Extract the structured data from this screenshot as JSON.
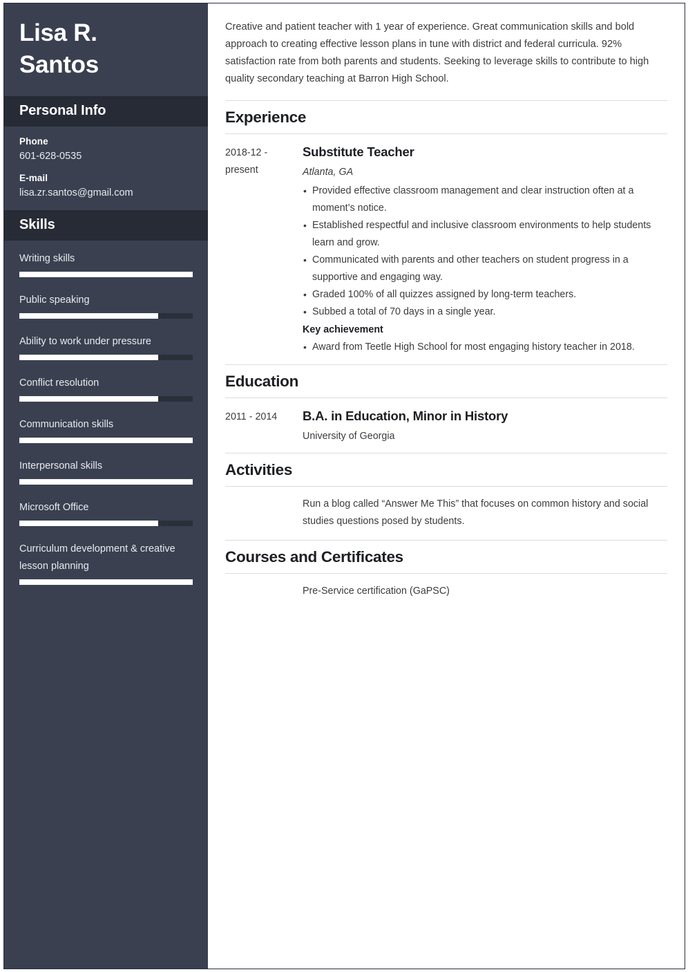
{
  "sidebar": {
    "name_lines": [
      "Lisa R.",
      "Santos"
    ],
    "personal_info": {
      "header": "Personal Info",
      "fields": [
        {
          "label": "Phone",
          "value": "601-628-0535"
        },
        {
          "label": "E-mail",
          "value": "lisa.zr.santos@gmail.com"
        }
      ]
    },
    "skills": {
      "header": "Skills",
      "items": [
        {
          "label": "Writing skills",
          "level": 100
        },
        {
          "label": "Public speaking",
          "level": 80
        },
        {
          "label": "Ability to work under pressure",
          "level": 80
        },
        {
          "label": "Conflict resolution",
          "level": 80
        },
        {
          "label": "Communication skills",
          "level": 100
        },
        {
          "label": "Interpersonal skills",
          "level": 100
        },
        {
          "label": "Microsoft Office",
          "level": 80
        },
        {
          "label": "Curriculum development & creative lesson planning",
          "level": 100
        }
      ]
    }
  },
  "main": {
    "summary": "Creative and patient teacher with 1 year of experience. Great communication skills and bold approach to creating effective lesson plans in tune with district and federal curricula. 92% satisfaction rate from both parents and students. Seeking to leverage skills to contribute to high quality secondary teaching at Barron High School.",
    "experience": {
      "title": "Experience",
      "entries": [
        {
          "dates": "2018-12 - present",
          "job_title": "Substitute Teacher",
          "location": "Atlanta, GA",
          "bullets": [
            "Provided effective classroom management and clear instruction often at a moment’s notice.",
            "Established respectful and inclusive classroom environments to help students learn and grow.",
            "Communicated with parents and other teachers on student progress in a supportive and engaging way.",
            "Graded 100% of all quizzes assigned by long-term teachers.",
            "Subbed a total of 70 days in a single year."
          ],
          "key_achievement_label": "Key achievement",
          "key_achievements": [
            "Award from Teetle High School for most engaging history teacher in 2018."
          ]
        }
      ]
    },
    "education": {
      "title": "Education",
      "entries": [
        {
          "dates": "2011 - 2014",
          "degree": "B.A. in Education, Minor in History",
          "school": "University of Georgia"
        }
      ]
    },
    "activities": {
      "title": "Activities",
      "entries": [
        {
          "dates": "",
          "text": "Run a blog called “Answer Me This” that focuses on common history and social studies questions posed by students."
        }
      ]
    },
    "courses": {
      "title": "Courses and Certificates",
      "entries": [
        {
          "dates": "",
          "text": "Pre-Service certification (GaPSC)"
        }
      ]
    }
  },
  "colors": {
    "sidebar_bg": "#3a4050",
    "sidebar_header_bg": "#272b35",
    "skill_fill": "#ffffff",
    "skill_track": "#2b2f3a",
    "main_text": "#3c3c3c",
    "heading_text": "#1d1f23",
    "divider": "#dcdcdc"
  }
}
